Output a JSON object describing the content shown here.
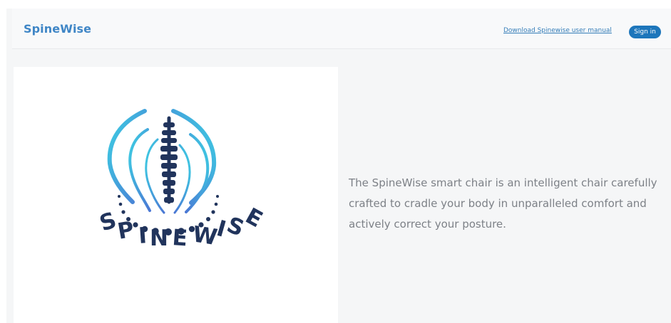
{
  "navbar": {
    "brand": "SpineWise",
    "manual_link": "Download Spinewise user manual",
    "signin_label": "Sign in"
  },
  "hero": {
    "logo_text": "SPINEWISE",
    "description": "The SpineWise smart chair is an intelligent chair carefully crafted to cradle your body in unparalleled comfort and actively correct your posture."
  },
  "colors": {
    "brand": "#3f86c6",
    "button": "#1d76bb",
    "logo_navy": "#21345c",
    "logo_cyan": "#3dd0e3",
    "logo_blue": "#4a77d4",
    "body_text": "#7d8187"
  }
}
